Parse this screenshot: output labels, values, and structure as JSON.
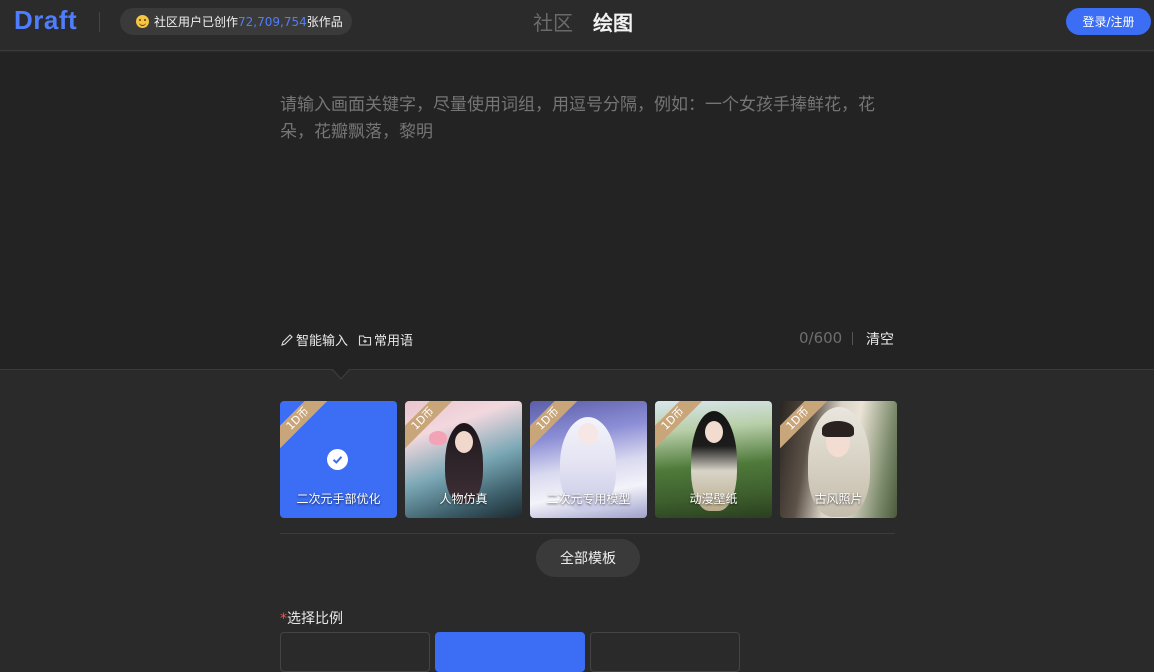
{
  "header": {
    "logo": "Draft",
    "stats_prefix": "社区用户已创作",
    "stats_count": "72,709,754",
    "stats_suffix": "张作品",
    "tabs": [
      {
        "label": "社区",
        "active": false
      },
      {
        "label": "绘图",
        "active": true
      }
    ],
    "login_label": "登录/注册"
  },
  "prompt": {
    "placeholder": "请输入画面关键字，尽量使用词组，用逗号分隔，例如：一个女孩手捧鲜花，花朵，花瓣飘落，黎明",
    "value": "",
    "tools": [
      {
        "label": "智能输入",
        "icon": "pencil-icon"
      },
      {
        "label": "常用语",
        "icon": "folder-plus-icon"
      }
    ],
    "counter": "0/600",
    "clear_label": "清空"
  },
  "templates": {
    "items": [
      {
        "label": "二次元手部优化",
        "badge": "1D币",
        "selected": true
      },
      {
        "label": "人物仿真",
        "badge": "1D币",
        "selected": false
      },
      {
        "label": "二次元专用模型",
        "badge": "1D币",
        "selected": false
      },
      {
        "label": "动漫壁纸",
        "badge": "1D币",
        "selected": false
      },
      {
        "label": "古风照片",
        "badge": "1D币",
        "selected": false
      }
    ],
    "all_label": "全部模板"
  },
  "ratio": {
    "required_mark": "*",
    "title": "选择比例"
  },
  "colors": {
    "accent": "#3b6df5",
    "logo": "#4f7dff",
    "badge": "#c9a57a"
  }
}
